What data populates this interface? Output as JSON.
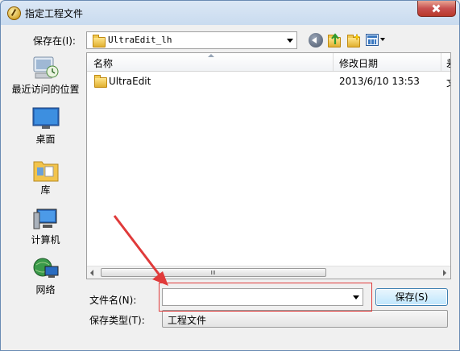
{
  "window": {
    "title": "指定工程文件"
  },
  "toolbar": {
    "save_in_label": "保存在(I):",
    "save_in_value": "UltraEdit_lh"
  },
  "places": [
    {
      "label": "最近访问的位置",
      "icon": "recent-places-icon"
    },
    {
      "label": "桌面",
      "icon": "desktop-icon"
    },
    {
      "label": "库",
      "icon": "libraries-icon"
    },
    {
      "label": "计算机",
      "icon": "computer-icon"
    },
    {
      "label": "网络",
      "icon": "network-icon"
    }
  ],
  "file_list": {
    "columns": [
      "名称",
      "修改日期",
      "差"
    ],
    "rows": [
      {
        "name": "UltraEdit",
        "date": "2013/6/10 13:53",
        "extra": "文"
      }
    ]
  },
  "bottom": {
    "filename_label": "文件名(N):",
    "filename_value": "",
    "filetype_label": "保存类型(T):",
    "filetype_value": "工程文件",
    "save_button": "保存(S)"
  },
  "colors": {
    "annotation": "#e03a3a",
    "accent": "#3c7fb1"
  }
}
